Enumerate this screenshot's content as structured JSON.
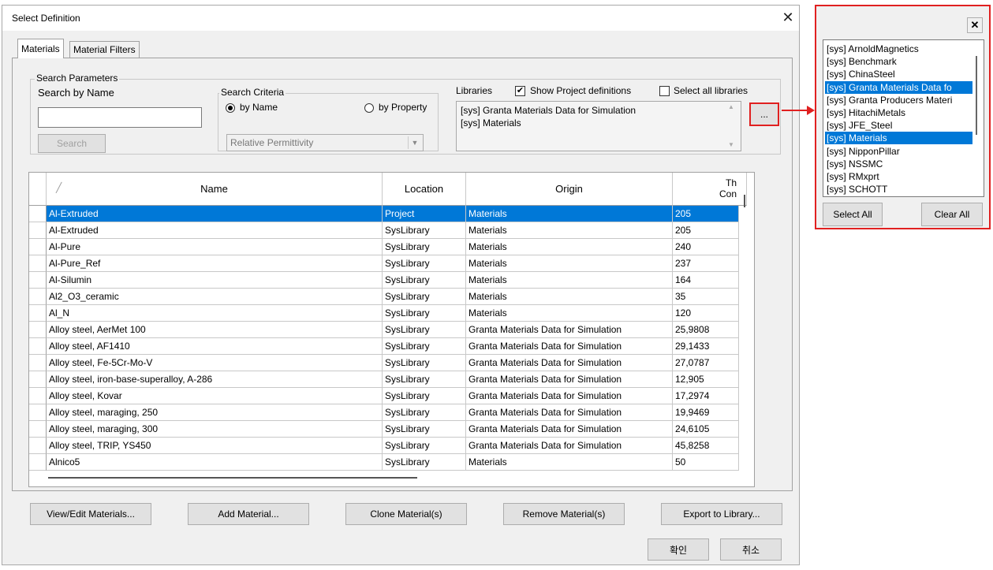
{
  "window": {
    "title": "Select Definition",
    "close_glyph": "✕"
  },
  "tabs": [
    {
      "label": "Materials"
    },
    {
      "label": "Material Filters"
    }
  ],
  "search_params": {
    "group_label": "Search Parameters",
    "name_label": "Search by Name",
    "name_value": "",
    "search_button": "Search"
  },
  "search_criteria": {
    "group_label": "Search Criteria",
    "by_name": "by Name",
    "by_property": "by Property",
    "selected": "by Name",
    "property_value": "Relative Permittivity"
  },
  "libraries": {
    "label": "Libraries",
    "show_project_label": "Show Project definitions",
    "show_project_checked": true,
    "select_all_label": "Select all libraries",
    "select_all_checked": false,
    "items": [
      "[sys] Granta Materials Data for Simulation",
      "[sys] Materials"
    ],
    "browse_button": "..."
  },
  "table": {
    "sort_glyph": "╱",
    "columns": [
      "Name",
      "Location",
      "Origin",
      "Th Con"
    ],
    "col4_line1": "Th",
    "col4_line2": "Con",
    "rows": [
      {
        "name": "Al-Extruded",
        "location": "Project",
        "origin": "Materials",
        "value": "205",
        "selected": true
      },
      {
        "name": "Al-Extruded",
        "location": "SysLibrary",
        "origin": "Materials",
        "value": "205"
      },
      {
        "name": "Al-Pure",
        "location": "SysLibrary",
        "origin": "Materials",
        "value": "240"
      },
      {
        "name": "Al-Pure_Ref",
        "location": "SysLibrary",
        "origin": "Materials",
        "value": "237"
      },
      {
        "name": "Al-Silumin",
        "location": "SysLibrary",
        "origin": "Materials",
        "value": "164"
      },
      {
        "name": "Al2_O3_ceramic",
        "location": "SysLibrary",
        "origin": "Materials",
        "value": "35"
      },
      {
        "name": "Al_N",
        "location": "SysLibrary",
        "origin": "Materials",
        "value": "120"
      },
      {
        "name": "Alloy steel, AerMet 100",
        "location": "SysLibrary",
        "origin": "Granta Materials Data for Simulation",
        "value": "25,9808"
      },
      {
        "name": "Alloy steel, AF1410",
        "location": "SysLibrary",
        "origin": "Granta Materials Data for Simulation",
        "value": "29,1433"
      },
      {
        "name": "Alloy steel, Fe-5Cr-Mo-V",
        "location": "SysLibrary",
        "origin": "Granta Materials Data for Simulation",
        "value": "27,0787"
      },
      {
        "name": "Alloy steel, iron-base-superalloy, A-286",
        "location": "SysLibrary",
        "origin": "Granta Materials Data for Simulation",
        "value": "12,905"
      },
      {
        "name": "Alloy steel, Kovar",
        "location": "SysLibrary",
        "origin": "Granta Materials Data for Simulation",
        "value": "17,2974"
      },
      {
        "name": "Alloy steel, maraging, 250",
        "location": "SysLibrary",
        "origin": "Granta Materials Data for Simulation",
        "value": "19,9469"
      },
      {
        "name": "Alloy steel, maraging, 300",
        "location": "SysLibrary",
        "origin": "Granta Materials Data for Simulation",
        "value": "24,6105"
      },
      {
        "name": "Alloy steel, TRIP, YS450",
        "location": "SysLibrary",
        "origin": "Granta Materials Data for Simulation",
        "value": "45,8258"
      },
      {
        "name": "Alnico5",
        "location": "SysLibrary",
        "origin": "Materials",
        "value": "50"
      }
    ]
  },
  "buttons": {
    "view_edit": "View/Edit Materials...",
    "add": "Add Material...",
    "clone": "Clone Material(s)",
    "remove": "Remove Material(s)",
    "export": "Export to Library...",
    "ok": "확인",
    "cancel": "취소"
  },
  "library_popup": {
    "close_glyph": "✕",
    "items": [
      {
        "label": "[sys] ArnoldMagnetics"
      },
      {
        "label": "[sys] Benchmark"
      },
      {
        "label": "[sys] ChinaSteel"
      },
      {
        "label": "[sys] Granta Materials Data fo",
        "selected": true
      },
      {
        "label": "[sys] Granta Producers Materi"
      },
      {
        "label": "[sys] HitachiMetals"
      },
      {
        "label": "[sys] JFE_Steel"
      },
      {
        "label": "[sys] Materials",
        "selected": true
      },
      {
        "label": "[sys] NipponPillar"
      },
      {
        "label": "[sys] NSSMC"
      },
      {
        "label": "[sys] RMxprt"
      },
      {
        "label": "[sys] SCHOTT"
      }
    ],
    "select_all": "Select All",
    "clear_all": "Clear All"
  },
  "colors": {
    "selection": "#0078d7",
    "highlight_box": "#e02020"
  }
}
